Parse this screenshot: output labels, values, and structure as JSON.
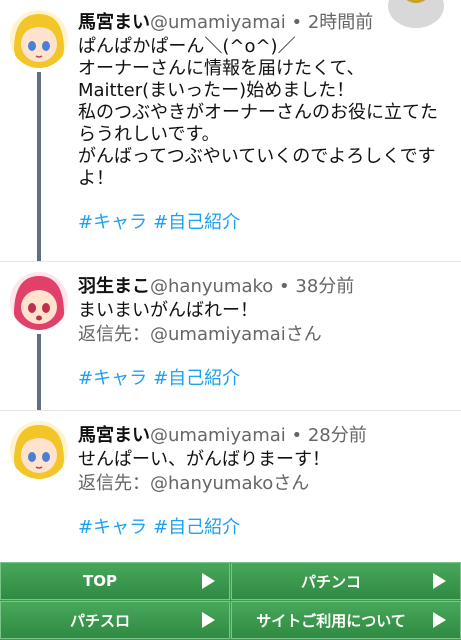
{
  "posts": [
    {
      "name": "馬宮まい",
      "handle": "@umamiyamai",
      "sep": "•",
      "time": "2時間前",
      "body": "ぱんぱかぱーん＼(^o^)／\nオーナーさんに情報を届けたくて、\nMaitter(まいったー)始めました！\n私のつぶやきがオーナーさんのお役に立てたらうれしいです。\nがんばってつぶやいていくのでよろしくですよ！",
      "tags": [
        "#キャラ",
        "#自己紹介"
      ]
    },
    {
      "name": "羽生まこ",
      "handle": "@hanyumako",
      "sep": "•",
      "time": "38分前",
      "body": "まいまいがんばれー！",
      "reply_prefix": "返信先：",
      "reply_to": "@umamiyamai",
      "reply_suffix": "さん",
      "tags": [
        "#キャラ",
        "#自己紹介"
      ]
    },
    {
      "name": "馬宮まい",
      "handle": "@umamiyamai",
      "sep": "•",
      "time": "28分前",
      "body": "せんぱーい、がんばりまーす！",
      "reply_prefix": "返信先：",
      "reply_to": "@hanyumako",
      "reply_suffix": "さん",
      "tags": [
        "#キャラ",
        "#自己紹介"
      ]
    }
  ],
  "footer": {
    "top": "TOP",
    "pachinko": "パチンコ",
    "pachislo": "パチスロ",
    "site_info": "サイトご利用について"
  },
  "colors": {
    "hashtag": "#1da1f2",
    "footer_green": "#3f9a52",
    "thread_line": "#5d6f80"
  }
}
